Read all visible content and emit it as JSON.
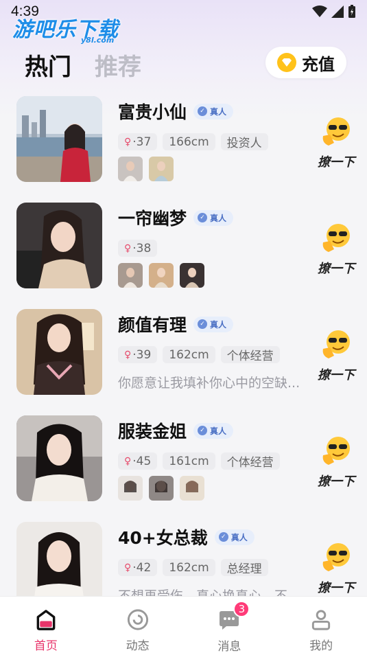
{
  "status": {
    "time": "4:39"
  },
  "watermark": {
    "text": "游吧乐下载",
    "sub": "y8l.com"
  },
  "tabs": [
    {
      "label": "热门",
      "active": true
    },
    {
      "label": "推荐",
      "active": false
    }
  ],
  "recharge": {
    "label": "充值"
  },
  "wave_label": "撩一下",
  "verified_label": "真人",
  "cards": [
    {
      "name": "富贵小仙",
      "age": "·37",
      "height": "166cm",
      "job": "投资人",
      "photos": 2,
      "bio": ""
    },
    {
      "name": "一帘幽梦",
      "age": "·38",
      "height": "",
      "job": "",
      "photos": 3,
      "bio": ""
    },
    {
      "name": "颜值有理",
      "age": "·39",
      "height": "162cm",
      "job": "个体经营",
      "photos": 0,
      "bio": "你愿意让我填补你心中的空缺..."
    },
    {
      "name": "服装金姐",
      "age": "·45",
      "height": "161cm",
      "job": "个体经营",
      "photos": 3,
      "bio": ""
    },
    {
      "name": "40+女总裁",
      "age": "·42",
      "height": "162cm",
      "job": "总经理",
      "photos": 0,
      "bio": "不想再受伤，真心换真心，不..."
    }
  ],
  "nav": [
    {
      "label": "首页",
      "icon": "home-icon",
      "active": true
    },
    {
      "label": "动态",
      "icon": "moments-icon",
      "active": false
    },
    {
      "label": "消息",
      "icon": "message-icon",
      "active": false,
      "badge": "3"
    },
    {
      "label": "我的",
      "icon": "profile-icon",
      "active": false
    }
  ],
  "colors": {
    "accent": "#e8346a",
    "coin": "#ffc21a",
    "badge": "#ff3b78",
    "verified": "#4a6fc4"
  }
}
